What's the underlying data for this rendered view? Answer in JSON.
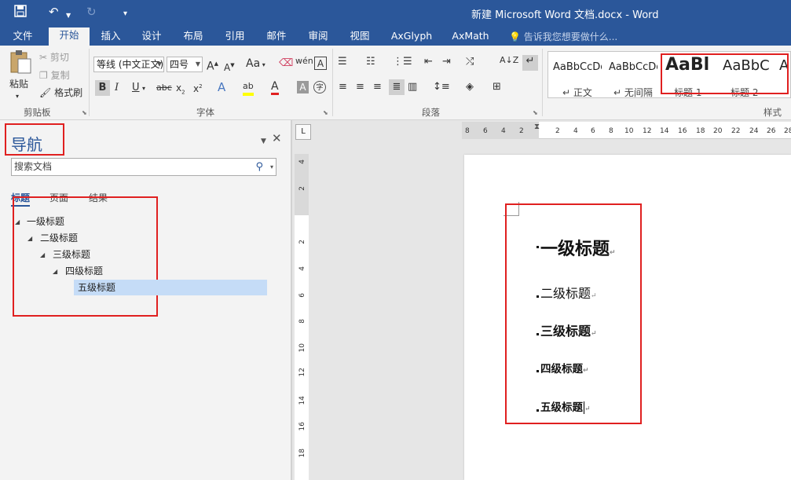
{
  "title_bar": {
    "doc_title": "新建 Microsoft Word 文档.docx - Word"
  },
  "ribbon_tabs": [
    {
      "label": "文件"
    },
    {
      "label": "开始"
    },
    {
      "label": "插入"
    },
    {
      "label": "设计"
    },
    {
      "label": "布局"
    },
    {
      "label": "引用"
    },
    {
      "label": "邮件"
    },
    {
      "label": "审阅"
    },
    {
      "label": "视图"
    },
    {
      "label": "AxGlyph"
    },
    {
      "label": "AxMath"
    }
  ],
  "tell_me": "告诉我您想要做什么...",
  "clipboard": {
    "paste": "粘贴",
    "cut": "剪切",
    "copy": "复制",
    "format_painter": "格式刷",
    "group_label": "剪贴板"
  },
  "font": {
    "name": "等线 (中文正文)",
    "size": "四号",
    "change_case": "Aa",
    "group_label": "字体"
  },
  "paragraph": {
    "group_label": "段落"
  },
  "styles": {
    "items": [
      {
        "sample": "AaBbCcDd",
        "name": "正文"
      },
      {
        "sample": "AaBbCcDd",
        "name": "无间隔"
      },
      {
        "sample": "AaBl",
        "name": "标题 1"
      },
      {
        "sample": "AaBbC",
        "name": "标题 2"
      },
      {
        "sample": "A",
        "name": ""
      }
    ],
    "group_label": "样式"
  },
  "nav_pane": {
    "title": "导航",
    "search_placeholder": "搜索文档",
    "tabs": [
      {
        "label": "标题"
      },
      {
        "label": "页面"
      },
      {
        "label": "结果"
      }
    ],
    "headings": [
      {
        "label": "一级标题",
        "level": 1
      },
      {
        "label": "二级标题",
        "level": 2
      },
      {
        "label": "三级标题",
        "level": 3
      },
      {
        "label": "四级标题",
        "level": 4
      },
      {
        "label": "五级标题",
        "level": 5
      }
    ]
  },
  "ruler": {
    "h_ticks": [
      "8",
      "6",
      "4",
      "2",
      "2",
      "4",
      "6",
      "8",
      "10",
      "12",
      "14",
      "16",
      "18",
      "20",
      "22",
      "24",
      "26",
      "28"
    ],
    "v_ticks": [
      "4",
      "2",
      "2",
      "4",
      "6",
      "8",
      "10",
      "12",
      "14",
      "16",
      "18"
    ]
  },
  "document": {
    "paragraphs": [
      {
        "text": "一级标题",
        "style": "标题 1"
      },
      {
        "text": "二级标题",
        "style": "标题 2"
      },
      {
        "text": "三级标题",
        "style": "标题 3"
      },
      {
        "text": "四级标题",
        "style": "标题 4"
      },
      {
        "text": "五级标题",
        "style": "标题 5"
      }
    ],
    "paragraph_mark": "↵"
  }
}
